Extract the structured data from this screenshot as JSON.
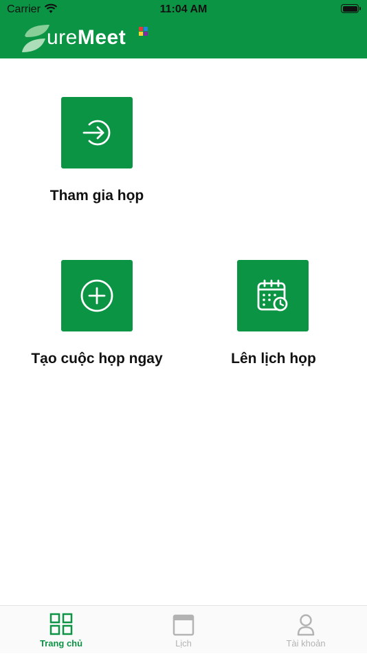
{
  "status_bar": {
    "carrier": "Carrier",
    "time": "11:04 AM"
  },
  "header": {
    "logo_prefix": "ure",
    "logo_suffix": "Meet",
    "brand_color": "#0a9444"
  },
  "actions": [
    {
      "label": "Tham gia họp",
      "icon": "login-arrow-icon"
    },
    {
      "label": "Tạo cuộc họp ngay",
      "icon": "plus-circle-icon"
    },
    {
      "label": "Lên lịch họp",
      "icon": "calendar-clock-icon"
    }
  ],
  "tabbar": {
    "items": [
      {
        "label": "Trang chủ",
        "icon": "grid-icon",
        "active": true
      },
      {
        "label": "Lịch",
        "icon": "calendar-icon",
        "active": false
      },
      {
        "label": "Tài khoản",
        "icon": "person-icon",
        "active": false
      }
    ],
    "active_color": "#0a9444",
    "inactive_color": "#b3b3b3"
  }
}
